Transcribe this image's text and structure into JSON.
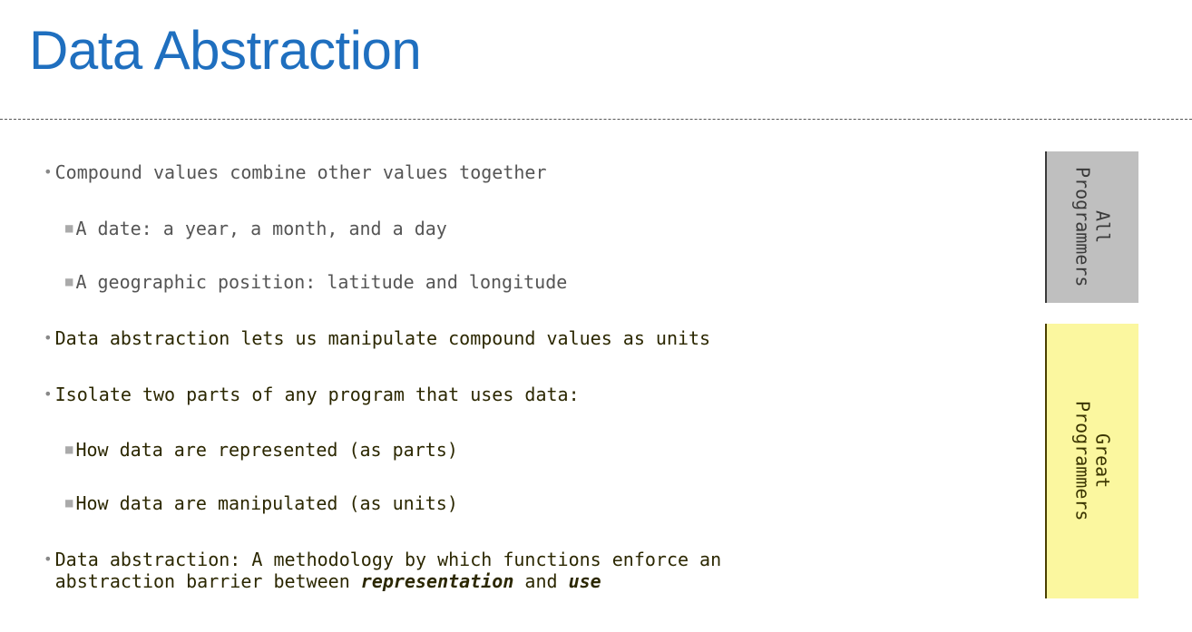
{
  "title": "Data Abstraction",
  "content": {
    "line1": "Compound values combine other values together",
    "line2": "A date: a year, a month, and a day",
    "line3": "A geographic position: latitude and longitude",
    "line4": "Data abstraction lets us manipulate compound values as units",
    "line5": "Isolate two parts of any program that uses data:",
    "line6": "How data are represented (as parts)",
    "line7": "How data are manipulated (as units)",
    "line8_a": "Data abstraction: A methodology by which functions enforce an",
    "line8_b": "abstraction barrier between ",
    "line8_emph1": "representation",
    "line8_mid": " and ",
    "line8_emph2": "use"
  },
  "bands": {
    "all": "All\nProgrammers",
    "great": "Great\nProgrammers"
  },
  "colors": {
    "title": "#1f6fbf",
    "all_band": "#bfbfbf",
    "great_band": "#fbf79f"
  }
}
